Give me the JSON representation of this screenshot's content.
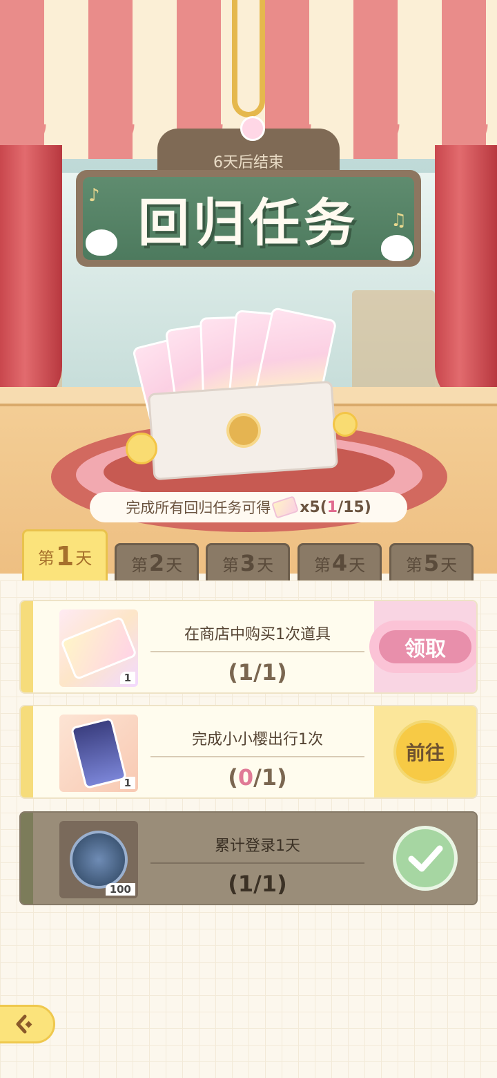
{
  "header": {
    "deadline": "6天后结束",
    "title": "回归任务"
  },
  "reward": {
    "prefix": "完成所有回归任务可得",
    "multiplier": "x5",
    "open": "(",
    "current": "1",
    "total": "/15)"
  },
  "tabs": [
    {
      "pre": "第",
      "num": "1",
      "post": "天",
      "active": true
    },
    {
      "pre": "第",
      "num": "2",
      "post": "天",
      "active": false
    },
    {
      "pre": "第",
      "num": "3",
      "post": "天",
      "active": false
    },
    {
      "pre": "第",
      "num": "4",
      "post": "天",
      "active": false
    },
    {
      "pre": "第",
      "num": "5",
      "post": "天",
      "active": false
    }
  ],
  "tasks": [
    {
      "title": "在商店中购买1次道具",
      "progress_open": "(",
      "progress_done": "1",
      "progress_rest": "/1)",
      "reward_qty": "1",
      "reward_icon": "ticket-icon",
      "action_label": "领取",
      "state": "claimable"
    },
    {
      "title": "完成小小樱出行1次",
      "progress_open": "(",
      "progress_done": "0",
      "progress_rest": "/1)",
      "reward_qty": "1",
      "reward_icon": "pass-icon",
      "action_label": "前往",
      "state": "in-progress"
    },
    {
      "title": "累计登录1天",
      "progress_open": "(",
      "progress_done": "1",
      "progress_rest": "/1)",
      "reward_qty": "100",
      "reward_icon": "coin-icon",
      "action_label": "",
      "state": "completed"
    }
  ],
  "colors": {
    "accent_yellow": "#fbe37b",
    "claim_pink": "#e88fab",
    "board_green": "#5f8c6f",
    "awning_red": "#e98c8a"
  }
}
